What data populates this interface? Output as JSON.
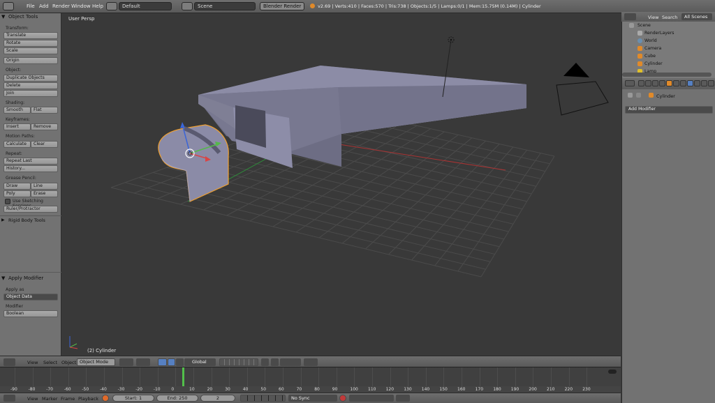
{
  "topbar": {
    "menus": [
      "File",
      "Add",
      "Render",
      "Window",
      "Help"
    ],
    "layout": "Default",
    "scene": "Scene",
    "engine": "Blender Render",
    "stats": "v2.69 | Verts:410 | Faces:570 | Tris:738 | Objects:1/5 | Lamps:0/1 | Mem:15.75M (0.14M) | Cylinder"
  },
  "toolshelf": {
    "title": "Object Tools",
    "transform_label": "Transform:",
    "translate": "Translate",
    "rotate": "Rotate",
    "scale": "Scale",
    "origin": "Origin",
    "object_label": "Object:",
    "duplicate": "Duplicate Objects",
    "delete": "Delete",
    "join": "Join",
    "shading_label": "Shading:",
    "smooth": "Smooth",
    "flat": "Flat",
    "keyframes_label": "Keyframes:",
    "insert": "Insert",
    "remove": "Remove",
    "motion_label": "Motion Paths:",
    "calculate": "Calculate",
    "clear": "Clear",
    "repeat_label": "Repeat:",
    "repeat_last": "Repeat Last",
    "history": "History...",
    "grease_label": "Grease Pencil:",
    "draw": "Draw",
    "line": "Line",
    "poly": "Poly",
    "erase": "Erase",
    "sketching": "Use Sketching Sessions",
    "ruler": "Ruler/Protractor",
    "rigid": "Rigid Body Tools",
    "apply_title": "Apply Modifier",
    "apply_as_label": "Apply as",
    "apply_as": "Object Data",
    "modifier_label": "Modifier",
    "modifier": "Boolean"
  },
  "viewport": {
    "view_name": "User Persp",
    "object_name": "(2) Cylinder"
  },
  "v3dheader": {
    "view": "View",
    "select": "Select",
    "object": "Object",
    "mode": "Object Mode",
    "orientation": "Global"
  },
  "timeline": {
    "ticks": [
      "-90",
      "-80",
      "-70",
      "-60",
      "-50",
      "-40",
      "-30",
      "-20",
      "-10",
      "0",
      "10",
      "20",
      "30",
      "40",
      "50",
      "60",
      "70",
      "80",
      "90",
      "100",
      "110",
      "120",
      "130",
      "140",
      "150",
      "160",
      "170",
      "180",
      "190",
      "200",
      "210",
      "220",
      "230"
    ],
    "current_frame": 2,
    "view": "View",
    "marker": "Marker",
    "frame": "Frame",
    "playback": "Playback",
    "start": "Start: 1",
    "end": "End: 250",
    "frame_value": "2",
    "sync": "No Sync"
  },
  "outliner": {
    "view": "View",
    "search": "Search",
    "all_scenes": "All Scenes",
    "items": [
      "Scene",
      "RenderLayers",
      "World",
      "Camera",
      "Cube",
      "Cylinder",
      "Lamp"
    ]
  },
  "properties": {
    "object": "Cylinder",
    "add_modifier": "Add Modifier"
  },
  "colors": {
    "selection": "#f0a030",
    "x_axis": "#d94545",
    "y_axis": "#55b84a",
    "z_axis": "#3a65d8",
    "active_tab": "#5680c2"
  }
}
